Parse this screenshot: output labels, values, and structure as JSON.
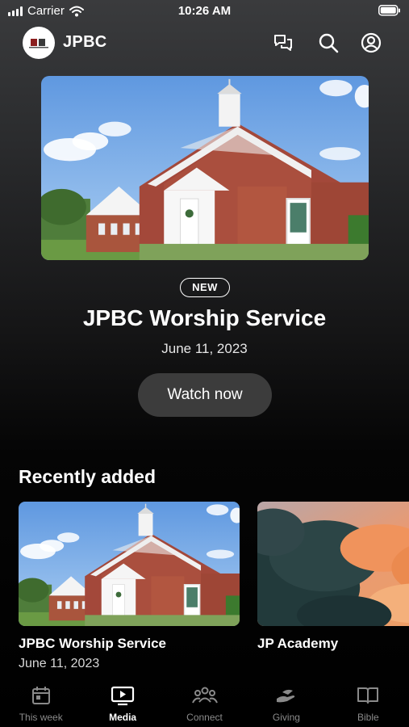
{
  "status_bar": {
    "carrier": "Carrier",
    "time": "10:26 AM"
  },
  "header": {
    "title": "JPBC"
  },
  "featured": {
    "badge": "NEW",
    "title": "JPBC Worship Service",
    "date": "June 11, 2023",
    "cta_label": "Watch now"
  },
  "recent": {
    "heading": "Recently added",
    "items": [
      {
        "title": "JPBC Worship Service",
        "date": "June 11, 2023",
        "thumbnail": "church-building"
      },
      {
        "title": "JP Academy",
        "date": "",
        "thumbnail": "sunset-clouds"
      }
    ]
  },
  "tabs": [
    {
      "label": "This week",
      "icon": "calendar-icon",
      "active": false
    },
    {
      "label": "Media",
      "icon": "tv-play-icon",
      "active": true
    },
    {
      "label": "Connect",
      "icon": "people-icon",
      "active": false
    },
    {
      "label": "Giving",
      "icon": "giving-hand-icon",
      "active": false
    },
    {
      "label": "Bible",
      "icon": "book-icon",
      "active": false
    }
  ],
  "colors": {
    "background_top": "#3a3b3d",
    "background_bottom": "#000000",
    "button_bg": "#3c3c3c",
    "tab_inactive": "#8a8a8a"
  }
}
